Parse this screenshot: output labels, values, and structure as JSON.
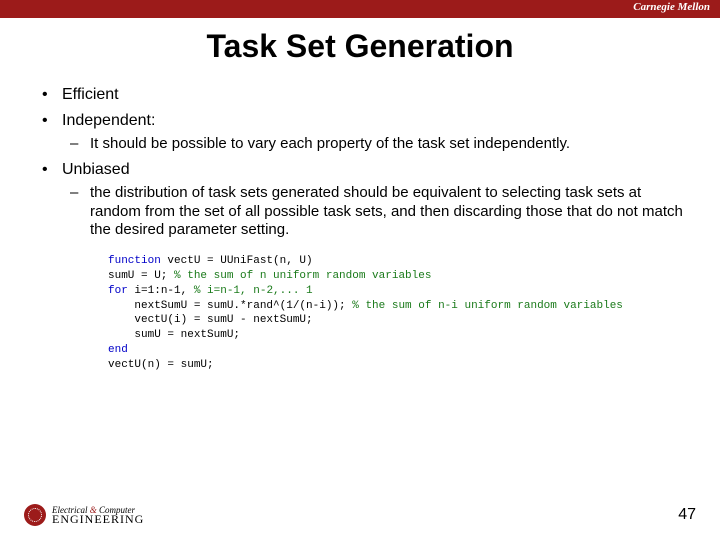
{
  "brand": "Carnegie Mellon",
  "title": "Task Set Generation",
  "bullets": {
    "b1": "Efficient",
    "b2": "Independent:",
    "b2s1": "It should be possible to vary each property of the task set independently.",
    "b3": "Unbiased",
    "b3s1": "the distribution of task sets generated should be equivalent to selecting task sets at random from the set of all possible task sets, and then discarding those that do not match the desired parameter setting."
  },
  "code": {
    "l1a": "function",
    "l1b": " vectU = UUniFast(n, U)",
    "l2a": "sumU = U; ",
    "l2b": "% the sum of n uniform random variables",
    "l3a": "for",
    "l3b": " i=1:n-1, ",
    "l3c": "% i=n-1, n-2,... 1",
    "l4a": "    nextSumU = sumU.*rand^(1/(n-i)); ",
    "l4b": "% the sum of n-i uniform random variables",
    "l5": "    vectU(i) = sumU - nextSumU;",
    "l6": "    sumU = nextSumU;",
    "l7": "end",
    "l8": "vectU(n) = sumU;"
  },
  "footer": {
    "line1a": "Electrical ",
    "line1amp": "&",
    "line1b": " Computer",
    "line2": "ENGINEERING"
  },
  "page": "47"
}
